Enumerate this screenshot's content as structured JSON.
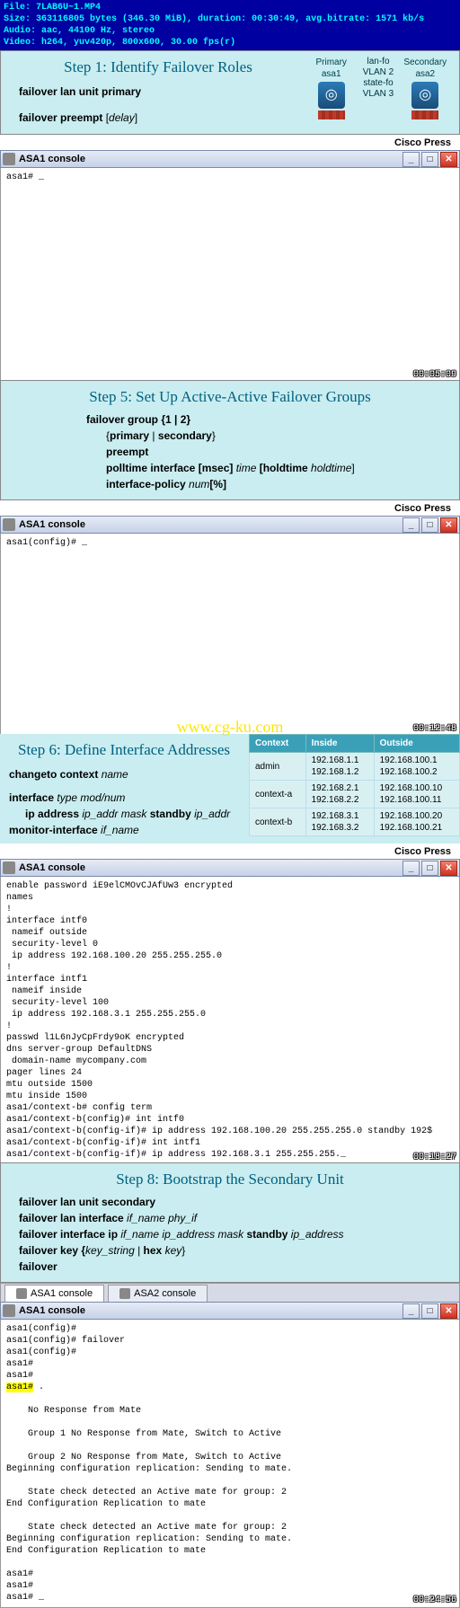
{
  "media": {
    "file_label": "File:",
    "file": "7LAB6U~1.MP4",
    "size_label": "Size:",
    "size": "363116805 bytes (346.30 MiB), duration: 00:30:49, avg.bitrate: 1571 kb/s",
    "audio_label": "Audio:",
    "audio": "aac, 44100 Hz, stereo",
    "video_label": "Video:",
    "video": "h264, yuv420p, 800x600, 30.00 fps(r)"
  },
  "step1": {
    "title": "Step 1: Identify Failover Roles",
    "line1a": "failover  lan  unit  primary",
    "line2a": "failover  preempt",
    "line2b": "   [",
    "line2c": "delay",
    "line2d": "]",
    "diag": {
      "primary": "Primary",
      "asa1": "asa1",
      "secondary": "Secondary",
      "asa2": "asa2",
      "lanfo": "lan-fo",
      "vlan2": "VLAN 2",
      "statefo": "state-fo",
      "vlan3": "VLAN 3"
    }
  },
  "cisco": "Cisco Press",
  "win1": {
    "title": "ASA1 console"
  },
  "console1": "asa1# _",
  "ts1": "00:05:09",
  "step5": {
    "title": "Step 5: Set Up Active-Active Failover Groups",
    "l1": "failover  group  {1  |  2}",
    "l2a": "{",
    "l2b": "primary ",
    "l2c": "|  ",
    "l2d": "secondary",
    "l2e": "}",
    "l3": "preempt",
    "l4a": "polltime  interface  [msec]",
    "l4b": "  time  ",
    "l4c": "[holdtime",
    "l4d": "  holdtime",
    "l4e": "]",
    "l5a": "interface-policy",
    "l5b": "   num",
    "l5c": "[%]"
  },
  "win2": {
    "title": "ASA1 console"
  },
  "console2": "asa1(config)# _",
  "watermark": "www.cg-ku.com",
  "ts2": "00:12:48",
  "step6": {
    "title": "Step 6: Define Interface Addresses",
    "l1a": "changeto  context",
    "l1b": "  name",
    "l2a": "interface",
    "l2b": "  type mod/num",
    "l3a": "ip address",
    "l3b": "  ip_addr mask",
    "l3c": " standby",
    "l3d": "  ip_addr",
    "l4a": "monitor-interface",
    "l4b": "  if_name",
    "th1": "Context",
    "th2": "Inside",
    "th3": "Outside",
    "r1c1": "admin",
    "r1c2": "192.168.1.1\n192.168.1.2",
    "r1c3": "192.168.100.1\n192.168.100.2",
    "r2c1": "context-a",
    "r2c2": "192.168.2.1\n192.168.2.2",
    "r2c3": "192.168.100.10\n192.168.100.11",
    "r3c1": "context-b",
    "r3c2": "192.168.3.1\n192.168.3.2",
    "r3c3": "192.168.100.20\n192.168.100.21"
  },
  "win3": {
    "title": "ASA1 console"
  },
  "console3": "enable password iE9elCMOvCJAfUw3 encrypted\nnames\n!\ninterface intf0\n nameif outside\n security-level 0\n ip address 192.168.100.20 255.255.255.0\n!\ninterface intf1\n nameif inside\n security-level 100\n ip address 192.168.3.1 255.255.255.0\n!\npasswd l1L6nJyCpFrdy9oK encrypted\ndns server-group DefaultDNS\n domain-name mycompany.com\npager lines 24\nmtu outside 1500\nmtu inside 1500\nasa1/context-b# config term\nasa1/context-b(config)# int intf0\nasa1/context-b(config-if)# ip address 192.168.100.20 255.255.255.0 standby 192$\nasa1/context-b(config-if)# int intf1\nasa1/context-b(config-if)# ip address 192.168.3.1 255.255.255._",
  "ts3": "00:18:27",
  "step8": {
    "title": "Step 8: Bootstrap the Secondary Unit",
    "l1": "failover  lan  unit  secondary",
    "l2a": "failover  lan  interface",
    "l2b": "  if_name  phy_if",
    "l3a": "failover  interface  ip",
    "l3b": "  if_name  ip_address mask",
    "l3c": " standby",
    "l3d": "  ip_address",
    "l4a": "failover  key  {",
    "l4b": "key_string",
    "l4c": "  |  ",
    "l4d": "hex",
    "l4e": "  key",
    "l4f": "}",
    "l5": "failover"
  },
  "tab1": "ASA1 console",
  "tab2": "ASA2 console",
  "win4": {
    "title": "ASA1 console"
  },
  "console4_a": "asa1(config)#\nasa1(config)# failover\nasa1(config)#\nasa1#\nasa1#\n",
  "console4_prompt": "asa1#",
  "console4_b": " .\n\n    No Response from Mate\n\n    Group 1 No Response from Mate, Switch to Active\n\n    Group 2 No Response from Mate, Switch to Active\nBeginning configuration replication: Sending to mate.\n\n    State check detected an Active mate for group: 2\nEnd Configuration Replication to mate\n\n    State check detected an Active mate for group: 2\nBeginning configuration replication: Sending to mate.\nEnd Configuration Replication to mate\n\nasa1#\nasa1#\nasa1# _",
  "ts4": "00:24:56",
  "chart_data": null
}
